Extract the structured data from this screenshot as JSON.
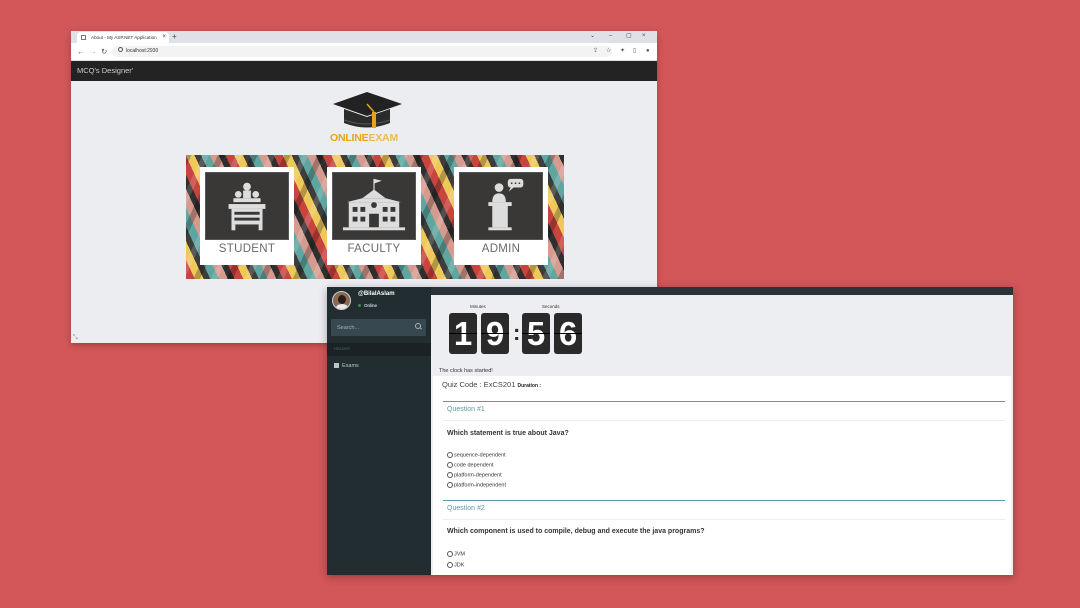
{
  "browser": {
    "tab_title": "About - My ASP.NET Application",
    "new_tab": "+",
    "url": "localhost:2930",
    "app_title": "MCQ's Designer'",
    "logo_text_1": "ONLINE",
    "logo_text_2": "EXAM",
    "cards": [
      {
        "label": "STUDENT",
        "icon": "students-desk-icon"
      },
      {
        "label": "FACULTY",
        "icon": "school-building-icon"
      },
      {
        "label": "ADMIN",
        "icon": "speaker-podium-icon"
      }
    ]
  },
  "quiz_app": {
    "user": {
      "name": "@BilalAslam",
      "status": "Online"
    },
    "search": {
      "placeholder": "Search..."
    },
    "section_header": "HEADER",
    "nav": [
      {
        "label": "Exams",
        "icon": "book-icon"
      }
    ],
    "clock": {
      "minutes_label": "Minutes",
      "seconds_label": "Seconds",
      "digits": [
        "1",
        "9",
        "5",
        "6"
      ],
      "separator": ":",
      "status": "The clock has started!"
    },
    "quiz": {
      "code_label": "Quiz Code : ExCS201",
      "duration_label": "Duration :"
    },
    "questions": [
      {
        "header": "Question #1",
        "text": "Which statement is true about Java?",
        "options": [
          "sequence-dependent",
          "code dependent",
          "platform-dependent",
          "platform-independent"
        ]
      },
      {
        "header": "Question #2",
        "text": "Which component is used to compile, debug and execute the java programs?",
        "options": [
          "JVM",
          "JDK"
        ]
      }
    ]
  },
  "colors": {
    "background": "#d35658",
    "accent_teal": "#5b9aa8",
    "sidebar": "#222d32",
    "logo_orange": "#e8a317"
  }
}
